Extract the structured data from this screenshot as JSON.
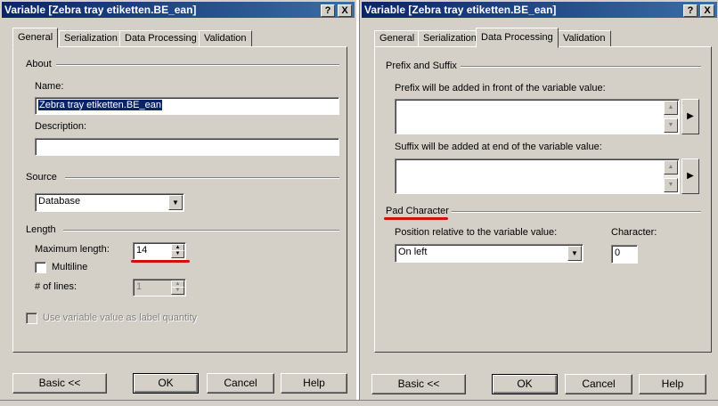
{
  "dialog1": {
    "title": "Variable [Zebra tray etiketten.BE_ean]",
    "help_btn": "?",
    "close_btn": "X",
    "tabs": [
      "General",
      "Serialization",
      "Data Processing",
      "Validation"
    ],
    "active_tab": "General",
    "about": {
      "group": "About",
      "name_label": "Name:",
      "name_value": "Zebra tray etiketten.BE_ean",
      "description_label": "Description:",
      "description_value": ""
    },
    "source": {
      "group": "Source",
      "value": "Database"
    },
    "length": {
      "group": "Length",
      "max_length_label": "Maximum length:",
      "max_length_value": "14",
      "multiline_label": "Multiline",
      "lines_label": "# of lines:",
      "lines_value": "1"
    },
    "use_label_quantity": "Use variable value as label quantity",
    "buttons": {
      "basic": "Basic <<",
      "ok": "OK",
      "cancel": "Cancel",
      "help": "Help"
    }
  },
  "dialog2": {
    "title": "Variable [Zebra tray etiketten.BE_ean]",
    "help_btn": "?",
    "close_btn": "X",
    "tabs": [
      "General",
      "Serialization",
      "Data Processing",
      "Validation"
    ],
    "active_tab": "Data Processing",
    "prefix_suffix": {
      "group": "Prefix and Suffix",
      "prefix_label": "Prefix will be added in front of the variable value:",
      "prefix_value": "",
      "suffix_label": "Suffix will be added at end of the variable value:",
      "suffix_value": ""
    },
    "pad": {
      "group": "Pad Character",
      "position_label": "Position relative to the variable value:",
      "position_value": "On left",
      "character_label": "Character:",
      "character_value": "0"
    },
    "buttons": {
      "basic": "Basic <<",
      "ok": "OK",
      "cancel": "Cancel",
      "help": "Help"
    }
  },
  "colors": {
    "title_start": "#0a246a",
    "title_end": "#3a6ea5",
    "face": "#d4d0c8",
    "annotation": "#d20f0f"
  }
}
